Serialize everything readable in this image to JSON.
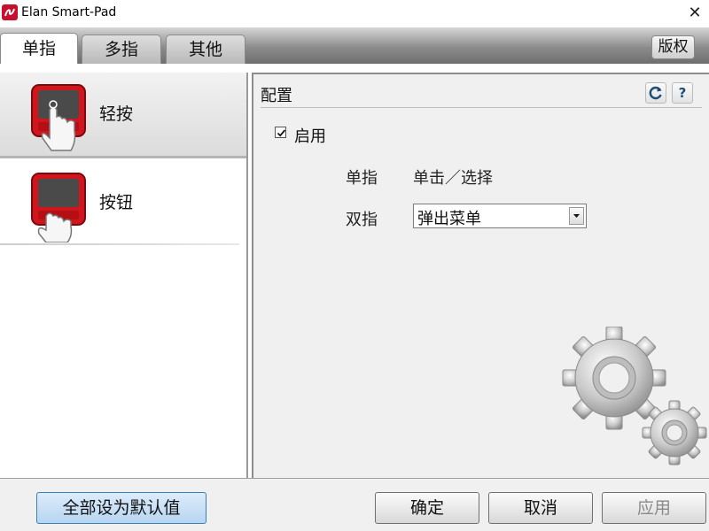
{
  "window": {
    "title": "Elan Smart-Pad"
  },
  "tabs": [
    {
      "label": "单指",
      "active": true
    },
    {
      "label": "多指",
      "active": false
    },
    {
      "label": "其他",
      "active": false
    }
  ],
  "copyright_button": "版权",
  "nav": {
    "items": [
      {
        "label": "轻按",
        "icon": "touchpad-tap-icon",
        "selected": true
      },
      {
        "label": "按钮",
        "icon": "touchpad-button-icon",
        "selected": false
      }
    ]
  },
  "config": {
    "title": "配置",
    "refresh_icon": "refresh-icon",
    "help_label": "?",
    "enable_label": "启用",
    "enabled": true,
    "single_finger_label": "单指",
    "single_finger_value": "单击／选择",
    "two_finger_label": "双指",
    "two_finger_value": "弹出菜单"
  },
  "buttons": {
    "restore_defaults": "全部设为默认值",
    "ok": "确定",
    "cancel": "取消",
    "apply": "应用"
  },
  "colors": {
    "accent_red": "#c8102e",
    "default_button_blue": "#b7d5f1"
  }
}
